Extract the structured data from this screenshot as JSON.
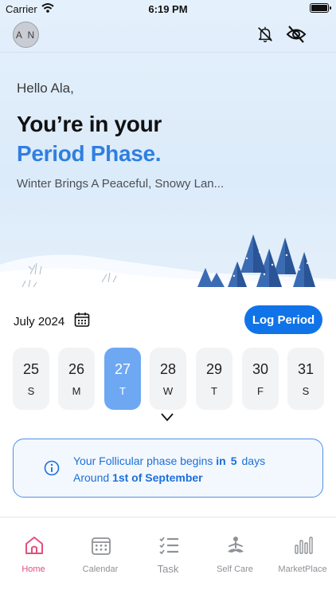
{
  "status_bar": {
    "carrier": "Carrier",
    "time": "6:19 PM"
  },
  "header": {
    "avatar_initials": "A N",
    "icons": [
      "bell-slash-icon",
      "eye-slash-icon"
    ]
  },
  "hero": {
    "greeting": "Hello Ala,",
    "phase_line1": "You’re in your",
    "phase_line2": "Period Phase.",
    "subtitle": "Winter Brings A Peaceful, Snowy Lan..."
  },
  "calendar": {
    "month": "July 2024",
    "log_button": "Log Period",
    "days": [
      {
        "num": "25",
        "wd": "S",
        "active": false
      },
      {
        "num": "26",
        "wd": "M",
        "active": false
      },
      {
        "num": "27",
        "wd": "T",
        "active": true
      },
      {
        "num": "28",
        "wd": "W",
        "active": false
      },
      {
        "num": "29",
        "wd": "T",
        "active": false
      },
      {
        "num": "30",
        "wd": "F",
        "active": false
      },
      {
        "num": "31",
        "wd": "S",
        "active": false
      }
    ]
  },
  "info": {
    "prefix": "Your Follicular phase begins",
    "in_word": "in",
    "count": "5",
    "suffix": "days",
    "around": "Around",
    "date": "1st of September"
  },
  "tabs": [
    {
      "label": "Home",
      "icon": "home-icon",
      "active": true
    },
    {
      "label": "Calendar",
      "icon": "calendar-icon",
      "active": false
    },
    {
      "label": "Task",
      "icon": "checklist-icon",
      "active": false
    },
    {
      "label": "Self Care",
      "icon": "meditation-icon",
      "active": false
    },
    {
      "label": "MarketPlace",
      "icon": "bar-chart-icon",
      "active": false
    }
  ],
  "colors": {
    "accent_blue": "#1173e8",
    "phase_blue": "#2f7fe0",
    "active_day": "#6ea8f2",
    "active_tab": "#e2507a"
  }
}
